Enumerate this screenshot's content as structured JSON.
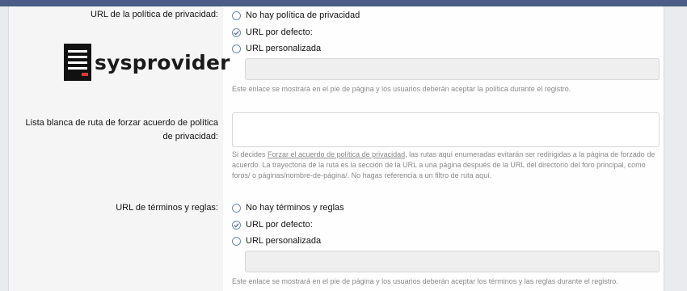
{
  "logo": {
    "text": "sysprovider"
  },
  "privacy": {
    "label": "URL de la política de privacidad:",
    "options": [
      {
        "label": "No hay política de privacidad",
        "selected": false
      },
      {
        "label": "URL por defecto:",
        "selected": true
      },
      {
        "label": "URL personalizada",
        "selected": false
      }
    ],
    "custom_url_value": "",
    "hint": "Este enlace se mostrará en el pie de página y los usuarios deberán aceptar la política durante el registro."
  },
  "whitelist": {
    "label_line1": "Lista blanca de ruta de forzar acuerdo de política",
    "label_line2": "de privacidad:",
    "value": "",
    "hint_pre": "Si decides ",
    "hint_link": "Forzar el acuerdo de política de privacidad",
    "hint_post": ", las rutas aquí enumeradas evitarán ser redirigidas a la página de forzado de acuerdo. La trayectoria de la ruta es la sección de la URL a una página después de la URL del directorio del foro principal, como foros/ o páginas/nombre-de-página/. No hagas referencia a un filtro de ruta aquí."
  },
  "terms": {
    "label": "URL de términos y reglas:",
    "options": [
      {
        "label": "No hay términos y reglas",
        "selected": false
      },
      {
        "label": "URL por defecto:",
        "selected": true
      },
      {
        "label": "URL personalizada",
        "selected": false
      }
    ],
    "custom_url_value": "",
    "hint": "Este enlace se mostrará en el pie de página y los usuarios deberán aceptar los términos y las reglas durante el registro."
  },
  "colors": {
    "header": "#4b5d86",
    "radio_border": "#6b86b4",
    "hint": "#8a8a8a"
  }
}
